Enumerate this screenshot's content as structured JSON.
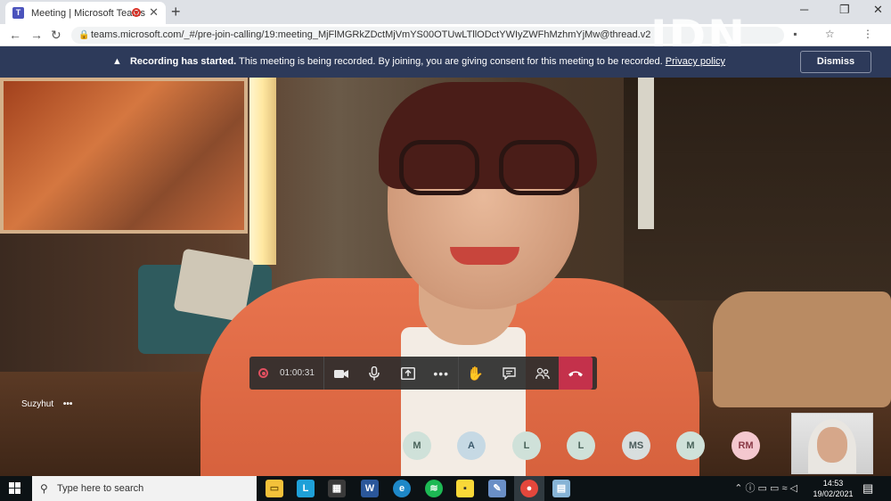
{
  "browser": {
    "tab_title": "Meeting | Microsoft Teams",
    "new_tab": "+",
    "url": "teams.microsoft.com/_#/pre-join-calling/19:meeting_MjFlMGRkZDctMjVmYS00OTUwLTllODctYWIyZWFhMzhmYjMw@thread.v2",
    "win_min": "─",
    "win_max": "❐",
    "win_close": "✕"
  },
  "watermark": "IDN TIMES",
  "banner": {
    "title": "Recording has started.",
    "message": "This meeting is being recorded. By joining, you are giving consent for this meeting to be recorded.",
    "link": "Privacy policy",
    "dismiss": "Dismiss"
  },
  "call": {
    "timer": "01:00:31",
    "speaker_name": "Suzyhut",
    "speaker_more": "•••",
    "participants": [
      "M",
      "A",
      "L",
      "L",
      "MS",
      "M",
      "RM"
    ]
  },
  "taskbar": {
    "search_placeholder": "Type here to search",
    "time": "14:53",
    "date": "19/02/2021",
    "apps": [
      "file-explorer",
      "l-app",
      "store",
      "word",
      "edge",
      "spotify",
      "sticky-notes",
      "paint",
      "chrome",
      "notepad"
    ]
  },
  "colors": {
    "banner_bg": "#2d3a5a",
    "hangup": "#c4314b",
    "record": "#e05060"
  }
}
